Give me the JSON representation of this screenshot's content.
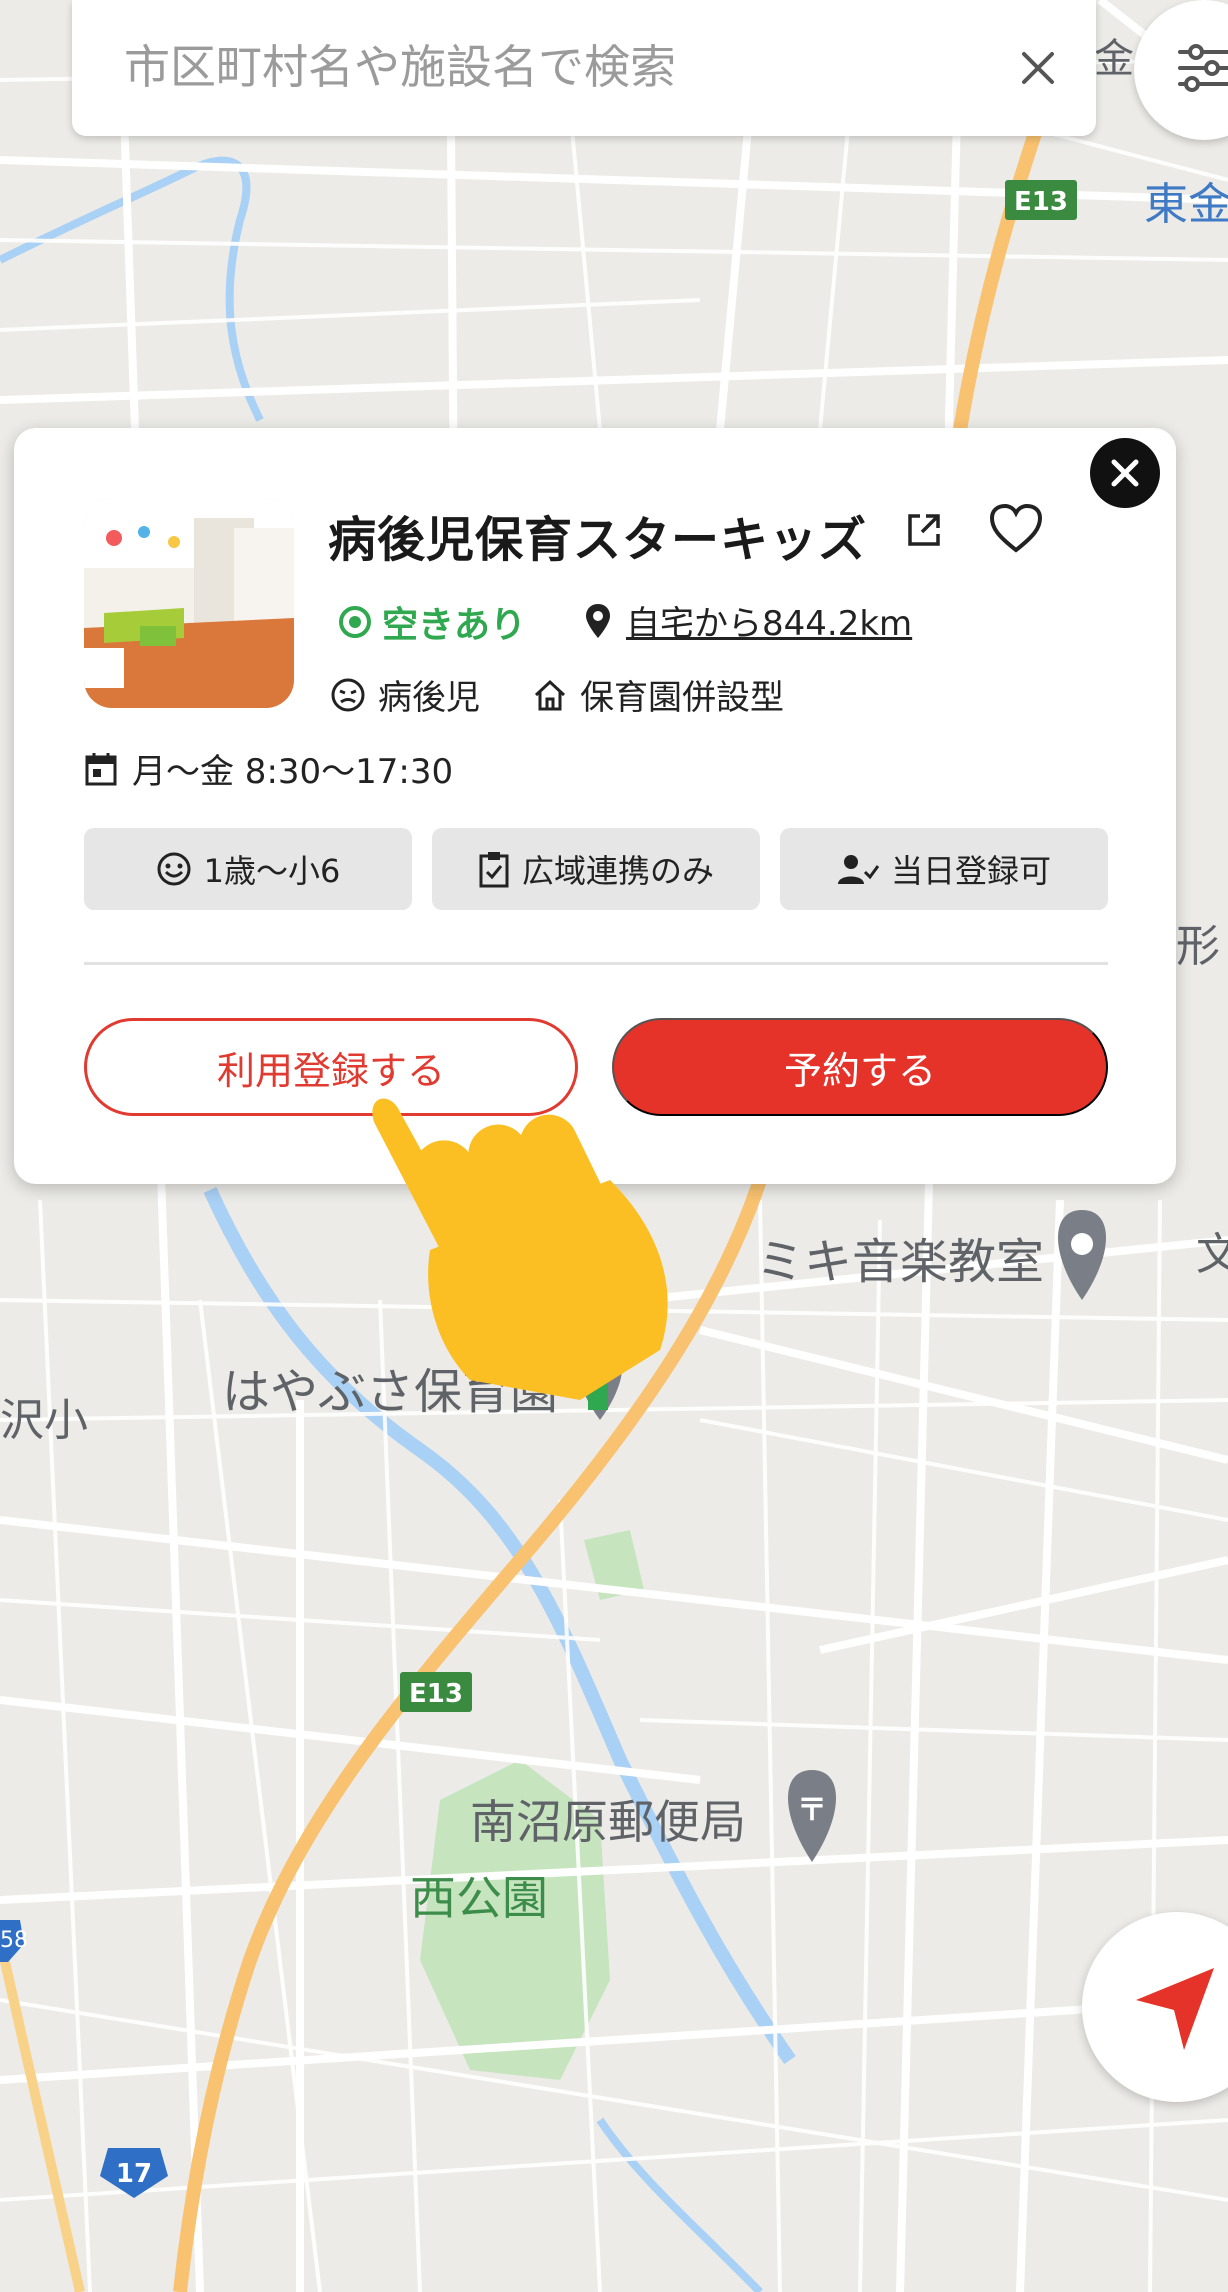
{
  "search": {
    "placeholder": "市区町村名や施設名で検索"
  },
  "map": {
    "labels": {
      "hayabusa": "はやぶさ保育園",
      "miki": "ミキ音楽教室",
      "post_office": "南沼原郵便局",
      "park": "西公園",
      "school_fragment": "沢小",
      "highway_top": "E13",
      "highway_mid": "E13",
      "route17": "17",
      "route_58": "58",
      "higashi": "東金",
      "kane_fragment": "金",
      "katachi_fragment": "形",
      "bun_fragment": "文"
    }
  },
  "facility": {
    "name": "病後児保育スターキッズ",
    "vacancy": "空きあり",
    "distance": "自宅から844.2km",
    "care_type": "病後児",
    "facility_type": "保育園併設型",
    "hours": "月〜金 8:30〜17:30",
    "chips": [
      "1歳〜小6",
      "広域連携のみ",
      "当日登録可"
    ]
  },
  "actions": {
    "register_label": "利用登録する",
    "reserve_label": "予約する"
  },
  "colors": {
    "accent_red": "#e5332a",
    "vacancy_green": "#2fa84f"
  }
}
